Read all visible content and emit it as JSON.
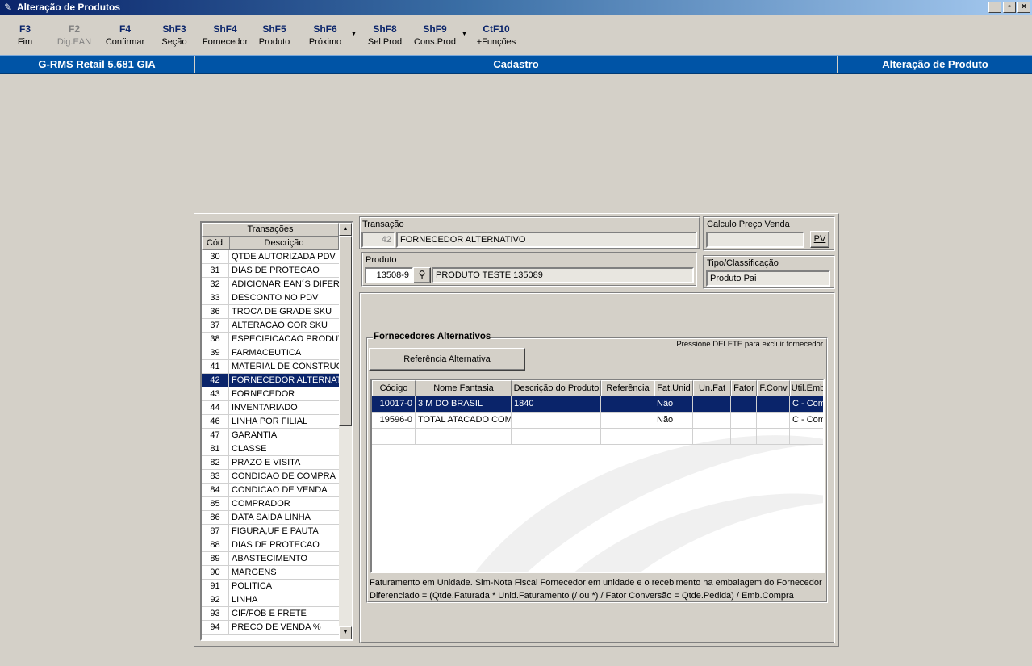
{
  "window": {
    "title": "Alteração de Produtos",
    "buttons": [
      "_",
      "▫",
      "×"
    ]
  },
  "toolbar": [
    {
      "key": "F3",
      "label": "Fim",
      "enabled": true
    },
    {
      "key": "F2",
      "label": "Dig.EAN",
      "enabled": false
    },
    {
      "key": "F4",
      "label": "Confirmar",
      "enabled": true
    },
    {
      "key": "ShF3",
      "label": "Seção",
      "enabled": true
    },
    {
      "key": "ShF4",
      "label": "Fornecedor",
      "enabled": true
    },
    {
      "key": "ShF5",
      "label": "Produto",
      "enabled": true
    },
    {
      "key": "ShF6",
      "label": "Próximo",
      "enabled": true
    },
    {
      "key": "ShF8",
      "label": "Sel.Prod",
      "enabled": true
    },
    {
      "key": "ShF9",
      "label": "Cons.Prod",
      "enabled": true
    },
    {
      "key": "CtF10",
      "label": "+Funções",
      "enabled": true
    }
  ],
  "header": {
    "left": "G-RMS Retail 5.681 GIA",
    "center": "Cadastro",
    "right": "Alteração de Produto"
  },
  "transactions": {
    "title": "Transações",
    "col_code": "Cód.",
    "col_desc": "Descrição",
    "selected_code": "42",
    "items": [
      {
        "code": "30",
        "desc": "QTDE AUTORIZADA PDV"
      },
      {
        "code": "31",
        "desc": "DIAS DE PROTECAO"
      },
      {
        "code": "32",
        "desc": "ADICIONAR EAN´S DIFERENTES"
      },
      {
        "code": "33",
        "desc": "DESCONTO NO PDV"
      },
      {
        "code": "36",
        "desc": "TROCA DE GRADE SKU"
      },
      {
        "code": "37",
        "desc": "ALTERACAO COR SKU"
      },
      {
        "code": "38",
        "desc": "ESPECIFICACAO PRODUTO"
      },
      {
        "code": "39",
        "desc": "FARMACEUTICA"
      },
      {
        "code": "41",
        "desc": "MATERIAL DE CONSTRUCAO"
      },
      {
        "code": "42",
        "desc": "FORNECEDOR ALTERNATIVO"
      },
      {
        "code": "43",
        "desc": "FORNECEDOR"
      },
      {
        "code": "44",
        "desc": "INVENTARIADO"
      },
      {
        "code": "46",
        "desc": "LINHA POR FILIAL"
      },
      {
        "code": "47",
        "desc": "GARANTIA"
      },
      {
        "code": "81",
        "desc": "CLASSE"
      },
      {
        "code": "82",
        "desc": "PRAZO E VISITA"
      },
      {
        "code": "83",
        "desc": "CONDICAO DE COMPRA"
      },
      {
        "code": "84",
        "desc": "CONDICAO DE VENDA"
      },
      {
        "code": "85",
        "desc": "COMPRADOR"
      },
      {
        "code": "86",
        "desc": "DATA SAIDA LINHA"
      },
      {
        "code": "87",
        "desc": "FIGURA,UF E PAUTA"
      },
      {
        "code": "88",
        "desc": "DIAS DE PROTECAO"
      },
      {
        "code": "89",
        "desc": "ABASTECIMENTO"
      },
      {
        "code": "90",
        "desc": "MARGENS"
      },
      {
        "code": "91",
        "desc": "POLITICA"
      },
      {
        "code": "92",
        "desc": "LINHA"
      },
      {
        "code": "93",
        "desc": "CIF/FOB E FRETE"
      },
      {
        "code": "94",
        "desc": "PRECO DE VENDA %"
      }
    ]
  },
  "transacao": {
    "label": "Transação",
    "code": "42",
    "desc": "FORNECEDOR ALTERNATIVO"
  },
  "produto": {
    "label": "Produto",
    "code": "13508-9",
    "desc": "PRODUTO TESTE 135089"
  },
  "calculo": {
    "label": "Calculo Preço Venda",
    "value": "",
    "button": "PV"
  },
  "tipo": {
    "label": "Tipo/Classificação",
    "value": "Produto Pai"
  },
  "fornecedores": {
    "title": "Fornecedores Alternativos",
    "hint": "Pressione DELETE para excluir fornecedor",
    "ref_button": "Referência Alternativa",
    "columns": [
      "Código",
      "Nome Fantasia",
      "Descrição do Produto",
      "Referência",
      "Fat.Unid",
      "Un.Fat",
      "Fator",
      "F.Conv",
      "Util.Emb"
    ],
    "rows": [
      [
        "10017-0",
        "3 M DO BRASIL",
        "1840",
        "",
        "Não",
        "",
        "",
        "",
        "C - Com"
      ],
      [
        "19596-0",
        "TOTAL ATACADO COM.",
        "",
        "",
        "Não",
        "",
        "",
        "",
        "C - Com"
      ],
      [
        "",
        "",
        "",
        "",
        "",
        "",
        "",
        "",
        ""
      ]
    ],
    "note1": "Faturamento em Unidade. Sim-Nota Fiscal Fornecedor em unidade e o recebimento na embalagem do Fornecedor",
    "note2": "Diferenciado = (Qtde.Faturada * Unid.Faturamento (/ ou *) / Fator Conversão  = Qtde.Pedida) / Emb.Compra"
  }
}
